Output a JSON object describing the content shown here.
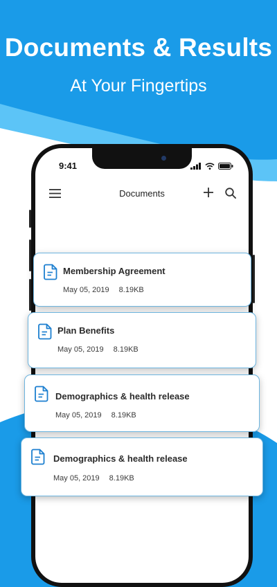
{
  "promo": {
    "headline": "Documents & Results",
    "subline": "At Your Fingertips"
  },
  "status_bar": {
    "time": "9:41",
    "icons": [
      "signal-icon",
      "wifi-icon",
      "battery-icon"
    ]
  },
  "nav": {
    "title": "Documents",
    "icons": [
      "menu-icon",
      "plus-icon",
      "search-icon"
    ]
  },
  "documents": [
    {
      "title": "Membership Agreement",
      "date": "May 05, 2019",
      "size": "8.19KB"
    },
    {
      "title": "Plan Benefits",
      "date": "May 05, 2019",
      "size": "8.19KB"
    },
    {
      "title": "Demographics & health release",
      "date": "May 05, 2019",
      "size": "8.19KB"
    },
    {
      "title": "Demographics & health release",
      "date": "May 05, 2019",
      "size": "8.19KB"
    }
  ],
  "colors": {
    "background_blue": "#1a9be8",
    "wave_light_blue": "#5cc4f7",
    "card_border": "#6cb4df",
    "doc_icon_blue": "#1c7fd0"
  }
}
